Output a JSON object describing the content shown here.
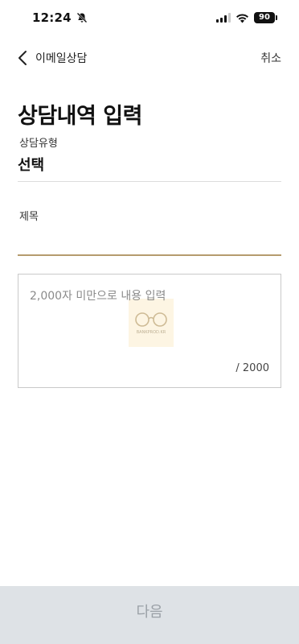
{
  "status_bar": {
    "time": "12:24",
    "battery": "90",
    "icons": [
      "bell-slash-icon",
      "signal-icon",
      "wifi-icon",
      "battery-icon"
    ]
  },
  "nav": {
    "back_icon": "chevron-left-icon",
    "back_label": "이메일상담",
    "cancel_label": "취소"
  },
  "page": {
    "title": "상담내역 입력"
  },
  "form": {
    "type_label": "상담유형",
    "type_value": "선택",
    "subject_label": "제목",
    "subject_value": "",
    "content_placeholder": "2,000자 미만으로 내용 입력",
    "content_value": "",
    "char_count": "/ 2000",
    "watermark_text": "BANKPROD.KR",
    "accent_color": "#b59b6e"
  },
  "footer": {
    "next_label": "다음",
    "button_color": "#dee2e6",
    "label_color": "#9ba1a7"
  }
}
